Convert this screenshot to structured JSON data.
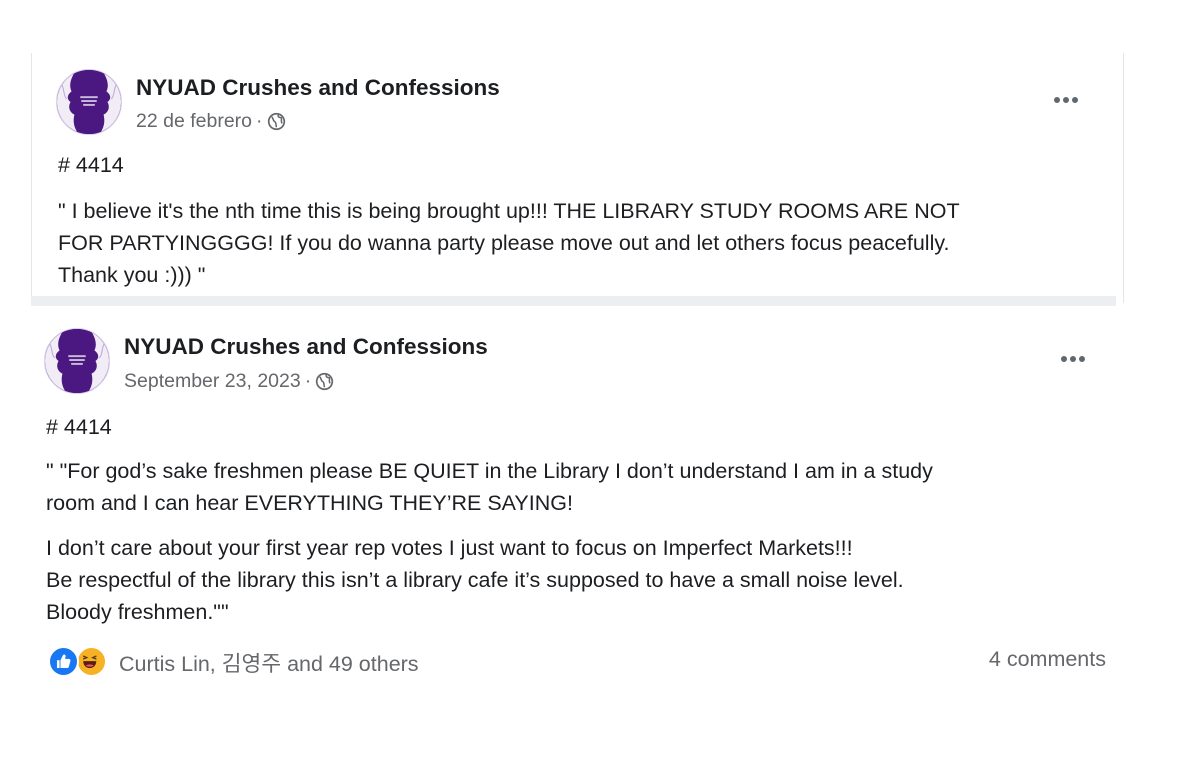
{
  "post1": {
    "page_name": "NYUAD Crushes and Confessions",
    "date": "22 de febrero",
    "dot": "·",
    "privacy_icon": "globe-icon",
    "more_icon": "more-options-icon",
    "number": "# 4414",
    "body_lines": [
      "\" I believe it's the nth time this is being brought up!!! THE LIBRARY STUDY ROOMS ARE NOT",
      "FOR PARTYINGGGG! If you do wanna party please move out and let others focus peacefully.",
      "Thank you :))) \""
    ]
  },
  "post2": {
    "page_name": "NYUAD Crushes and Confessions",
    "date": "September 23, 2023",
    "dot": "·",
    "privacy_icon": "globe-icon",
    "more_icon": "more-options-icon",
    "number": "# 4414",
    "body_lines": [
      "\" \"For god’s sake freshmen please BE QUIET in the Library I don’t understand I am in a study",
      "room and I can hear EVERYTHING THEY’RE SAYING!",
      "I don’t care about your first year rep votes I just want to focus on Imperfect Markets!!!",
      "Be respectful of the library this isn’t a library cafe it’s supposed to have a small noise level.",
      "Bloody freshmen.\"\""
    ],
    "reactions_text": "Curtis Lin, 김영주 and 49 others",
    "reaction_icons": [
      "like-icon",
      "haha-icon"
    ],
    "comments_text": "4 comments"
  },
  "colors": {
    "avatar_purple": "#4b1780",
    "text_primary": "#1c1e21",
    "text_secondary": "#65676b",
    "like_blue": "#1877f2",
    "haha_yellow": "#f7b125",
    "separator_gray": "#eceef2"
  }
}
